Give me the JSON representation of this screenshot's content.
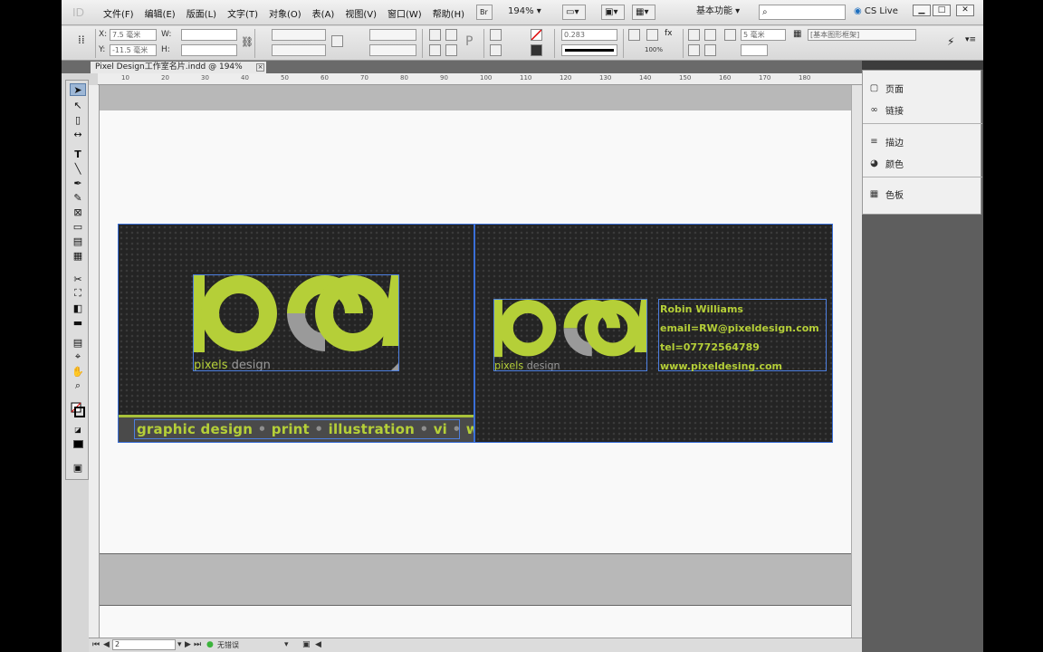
{
  "app": {
    "logo": "ID"
  },
  "menu": [
    "文件(F)",
    "编辑(E)",
    "版面(L)",
    "文字(T)",
    "对象(O)",
    "表(A)",
    "视图(V)",
    "窗口(W)",
    "帮助(H)"
  ],
  "menubar": {
    "br_label": "Br",
    "zoom": "194%",
    "workspace": "基本功能",
    "search_placeholder": "",
    "cs_live": "CS Live"
  },
  "control_panel": {
    "x_label": "X:",
    "x_value": "7.5 毫米",
    "y_label": "Y:",
    "y_value": "-11.5 毫米",
    "w_label": "W:",
    "h_label": "H:",
    "stroke_weight": "0.283",
    "percent": "100%",
    "gap_value": "5 毫米",
    "frame_style": "[基本图形框架]"
  },
  "document_tab": {
    "title": "Pixel Design工作室名片.indd @ 194%",
    "close": "×"
  },
  "ruler_numbers": [
    "10",
    "20",
    "30",
    "40",
    "50",
    "60",
    "70",
    "80",
    "90",
    "100",
    "110",
    "120",
    "130",
    "140",
    "150",
    "160",
    "170",
    "180"
  ],
  "card_front": {
    "brand": "pixels design",
    "tagline": [
      "graphic design",
      "print",
      "illustration",
      "vi",
      "web"
    ],
    "separator": "•"
  },
  "card_back": {
    "brand": "pixels design",
    "name": "Robin Williams",
    "email": "email=RW@pixeldesign.com",
    "tel": "tel=07772564789",
    "web": "www.pixeldesing.com"
  },
  "panels": {
    "items": [
      {
        "icon": "pages-icon",
        "label": "页面"
      },
      {
        "icon": "links-icon",
        "label": "链接"
      },
      {
        "icon": "stroke-icon",
        "label": "描边"
      },
      {
        "icon": "color-icon",
        "label": "颜色"
      },
      {
        "icon": "swatches-icon",
        "label": "色板"
      }
    ]
  },
  "statusbar": {
    "page": "2",
    "errors": "无错误"
  },
  "colors": {
    "brand_green": "#b5cf38",
    "brand_grey": "#9a9a9a",
    "card_bg": "#242424",
    "frame_blue": "#4d7fe0"
  }
}
